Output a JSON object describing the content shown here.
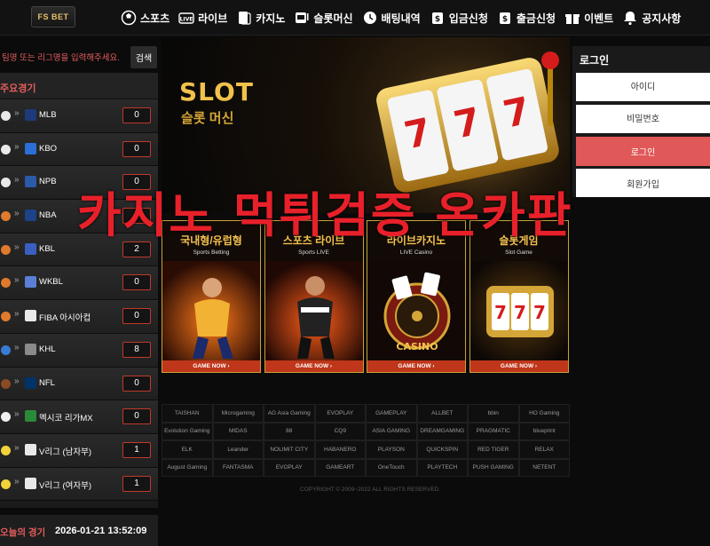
{
  "header": {
    "logo": "FS BET",
    "nav": [
      {
        "label": "스포츠",
        "icon": "soccer-ball-icon"
      },
      {
        "label": "라이브",
        "icon": "live-icon"
      },
      {
        "label": "카지노",
        "icon": "cards-icon"
      },
      {
        "label": "슬롯머신",
        "icon": "slot-icon"
      },
      {
        "label": "배팅내역",
        "icon": "history-icon"
      },
      {
        "label": "입금신청",
        "icon": "deposit-icon"
      },
      {
        "label": "출금신청",
        "icon": "withdraw-icon"
      },
      {
        "label": "이벤트",
        "icon": "gift-icon"
      },
      {
        "label": "공지사항",
        "icon": "bell-icon"
      }
    ]
  },
  "search": {
    "placeholder": "팀명 또는 리그명을 입력해주세요.",
    "button": "검색"
  },
  "leagues": {
    "title": "주요경기",
    "items": [
      {
        "name": "MLB",
        "count": "0",
        "ball": "#e9e9e9",
        "logo": "#1f3a7a"
      },
      {
        "name": "KBO",
        "count": "0",
        "ball": "#e9e9e9",
        "logo": "#2b6fd6"
      },
      {
        "name": "NPB",
        "count": "0",
        "ball": "#e9e9e9",
        "logo": "#2a5aa8"
      },
      {
        "name": "NBA",
        "count": "0",
        "ball": "#e07a2c",
        "logo": "#1d428a"
      },
      {
        "name": "KBL",
        "count": "2",
        "ball": "#e07a2c",
        "logo": "#3b5fc0"
      },
      {
        "name": "WKBL",
        "count": "0",
        "ball": "#e07a2c",
        "logo": "#5b7fd6"
      },
      {
        "name": "FIBA 아시아컵",
        "count": "0",
        "ball": "#e07a2c",
        "logo": "#e9e9e9"
      },
      {
        "name": "KHL",
        "count": "8",
        "ball": "#3a7bd5",
        "logo": "#8a8a8a"
      },
      {
        "name": "NFL",
        "count": "0",
        "ball": "#8b4a24",
        "logo": "#013369"
      },
      {
        "name": "멕시코 리가MX",
        "count": "0",
        "ball": "#f0f0f0",
        "logo": "#2a8a3a"
      },
      {
        "name": "V리그 (남자부)",
        "count": "1",
        "ball": "#f3d23a",
        "logo": "#e9e9e9"
      },
      {
        "name": "V리그 (여자부)",
        "count": "1",
        "ball": "#f3d23a",
        "logo": "#e9e9e9"
      }
    ]
  },
  "today": {
    "label": "오늘의 경기",
    "time": "2026-01-21 13:52:09"
  },
  "banner": {
    "title": "SLOT",
    "subtitle": "슬롯 머신"
  },
  "overlay": "카지노 먹튀검증 온카판",
  "categories": [
    {
      "title": "국내형/유럽형",
      "sub": "Sports Betting",
      "cta": "GAME NOW ›"
    },
    {
      "title": "스포츠 라이브",
      "sub": "Sports LIVE",
      "cta": "GAME NOW ›"
    },
    {
      "title": "라이브카지노",
      "sub": "LIVE Casino",
      "cta": "GAME NOW ›"
    },
    {
      "title": "슬롯게임",
      "sub": "Slot Game",
      "cta": "GAME NOW ›"
    }
  ],
  "providers": [
    "TAISHAN",
    "Microgaming",
    "AG Asia Gaming",
    "EVOPLAY",
    "GAMEPLAY",
    "ALLBET",
    "bbin",
    "HO Gaming",
    "Evolution Gaming",
    "MIDAS",
    "88",
    "CQ9",
    "ASIA GAMING",
    "DREAMGAMING",
    "PRAGMATIC",
    "blueprint",
    "ELK",
    "Leander",
    "NOLIMIT CITY",
    "HABANERO",
    "PLAYSON",
    "QUICKSPIN",
    "RED TIGER",
    "RELAX",
    "August Gaming",
    "FANTASMA",
    "EVOPLAY",
    "GAMEART",
    "OneTouch",
    "PLAYTECH",
    "PUSH GAMING",
    "NETENT"
  ],
  "copyright": "COPYRIGHT © 2009~2022 ALL RIGHTS RESERVED.",
  "login": {
    "title": "로그인",
    "id_placeholder": "아이디",
    "pw_placeholder": "비밀번호",
    "login_button": "로그인",
    "join_button": "회원가입"
  }
}
